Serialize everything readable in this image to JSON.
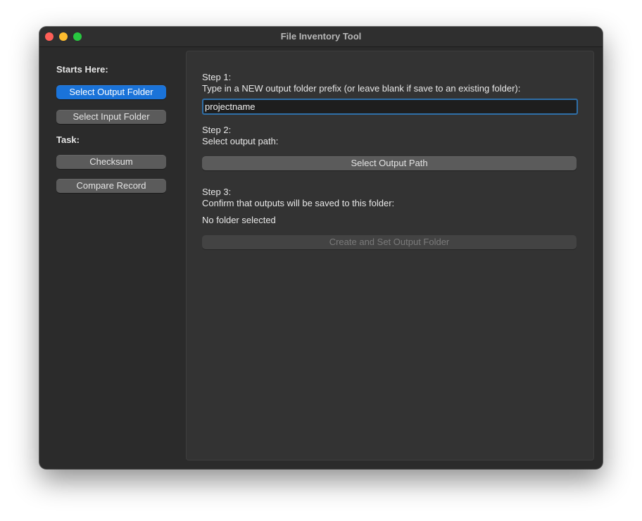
{
  "window": {
    "title": "File Inventory Tool"
  },
  "sidebar": {
    "starts_label": "Starts Here:",
    "select_output_folder": "Select Output Folder",
    "select_input_folder": "Select Input Folder",
    "task_label": "Task:",
    "checksum": "Checksum",
    "compare_record": "Compare Record"
  },
  "main": {
    "step1_title": "Step 1:",
    "step1_desc": "Type in a NEW output folder prefix (or leave blank if save to an existing folder):",
    "prefix_value": "projectname",
    "step2_title": "Step 2:",
    "step2_desc": "Select output path:",
    "select_output_path": "Select Output Path",
    "step3_title": "Step 3:",
    "step3_desc": "Confirm that outputs will be saved to this folder:",
    "folder_status": "No folder selected",
    "create_button": "Create and Set Output Folder"
  },
  "colors": {
    "accent": "#1a73d9",
    "window_bg": "#2b2b2b",
    "panel_bg": "#333333"
  }
}
